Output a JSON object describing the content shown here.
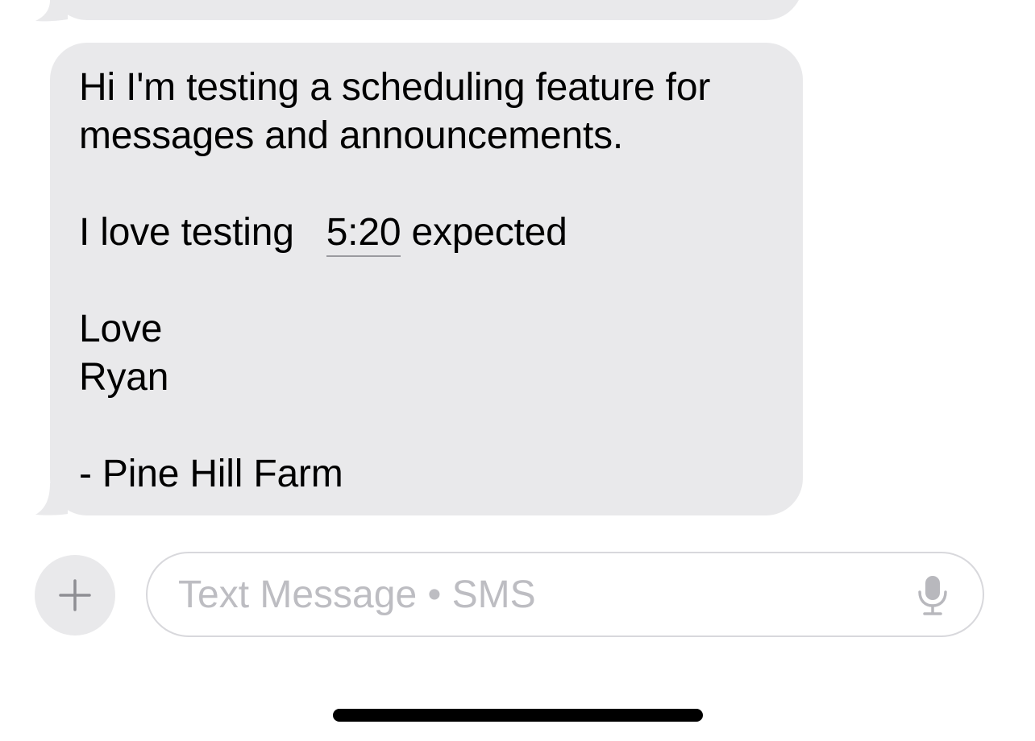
{
  "conversation": {
    "message": {
      "line1": "Hi I'm testing a scheduling feature for",
      "line2": "messages and announcements.",
      "line3_prefix": "I love testing",
      "line3_time": "5:20",
      "line3_suffix": "expected",
      "line4": "Love",
      "line5": "Ryan",
      "line6": "- Pine Hill Farm"
    }
  },
  "compose": {
    "placeholder": "Text Message • SMS",
    "add_icon": "plus-icon",
    "mic_icon": "microphone-icon"
  },
  "colors": {
    "incoming_bubble": "#e9e9eb",
    "placeholder": "#bdbdc2",
    "icon_gray": "#8e8e93"
  }
}
